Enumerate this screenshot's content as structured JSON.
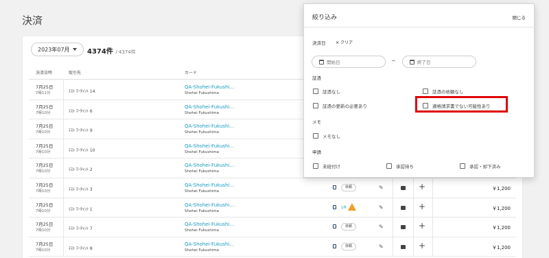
{
  "page_title": "決済",
  "toolbar": {
    "month": "2023年07月",
    "count_main": "4374件",
    "count_sub": "/ 4374件"
  },
  "table": {
    "headers": [
      "決済日時",
      "取引先",
      "カード"
    ],
    "rows": [
      {
        "date": "7月25日",
        "time": "7時11分",
        "partner": "ﾃｽﾄ ﾏｰﾁｬﾝﾄ 14",
        "card": "QA-Shohei-Fukushi…",
        "holder": "Shohei Fukushima",
        "status": "",
        "amount": ""
      },
      {
        "date": "7月25日",
        "time": "7時10分",
        "partner": "ﾃｽﾄ ﾏｰﾁｬﾝﾄ 6",
        "card": "QA-Shohei-Fukushi…",
        "holder": "Shohei Fukushima",
        "status": "",
        "amount": ""
      },
      {
        "date": "7月25日",
        "time": "7時10分",
        "partner": "ﾃｽﾄ ﾏｰﾁｬﾝﾄ 9",
        "card": "QA-Shohei-Fukushi…",
        "holder": "Shohei Fukushima",
        "status": "",
        "amount": ""
      },
      {
        "date": "7月25日",
        "time": "7時10分",
        "partner": "ﾃｽﾄ ﾏｰﾁｬﾝﾄ 10",
        "card": "QA-Shohei-Fukushi…",
        "holder": "Shohei Fukushima",
        "status": "",
        "amount": ""
      },
      {
        "date": "7月25日",
        "time": "7時10分",
        "partner": "ﾃｽﾄ ﾏｰﾁｬﾝﾄ 2",
        "card": "QA-Shohei-Fukushi…",
        "holder": "Shohei Fukushima",
        "status": "",
        "amount": ""
      },
      {
        "date": "7月25日",
        "time": "7時10分",
        "partner": "ﾃｽﾄ ﾏｰﾁｬﾝﾄ 3",
        "card": "QA-Shohei-Fukushi…",
        "holder": "Shohei Fukushima",
        "status": "依頼",
        "amount": "￥1,200"
      },
      {
        "date": "7月25日",
        "time": "7時10分",
        "partner": "ﾃｽﾄ ﾏｰﾁｬﾝﾄ 1",
        "card": "QA-Shohei-Fukushi…",
        "holder": "Shohei Fukushima",
        "status": "1件",
        "amount": "￥1,200"
      },
      {
        "date": "7月25日",
        "time": "7時10分",
        "partner": "ﾃｽﾄ ﾏｰﾁｬﾝﾄ 7",
        "card": "QA-Shohei-Fukushi…",
        "holder": "Shohei Fukushima",
        "status": "依頼",
        "amount": "￥1,200"
      },
      {
        "date": "7月25日",
        "time": "7時10分",
        "partner": "ﾃｽﾄ ﾏｰﾁｬﾝﾄ 8",
        "card": "QA-Shohei-Fukushi…",
        "holder": "Shohei Fukushima",
        "status": "依頼",
        "amount": "￥1,200"
      }
    ]
  },
  "filter": {
    "title": "絞り込み",
    "close": "閉じる",
    "date_label": "決済日",
    "clear": "クリア",
    "start_placeholder": "開始日",
    "end_placeholder": "終了日",
    "tilde": "~",
    "voucher_label": "証憑",
    "voucher_options": [
      "証憑なし",
      "証憑の依頼なし",
      "証憑の更新の必要あり",
      "適格請求書でない可能性あり"
    ],
    "memo_label": "メモ",
    "memo_options": [
      "メモなし"
    ],
    "approval_label": "申請",
    "approval_options": [
      "未紐付け",
      "承認待ち",
      "承認・却下済み"
    ],
    "highlight_color": "#e00000"
  }
}
